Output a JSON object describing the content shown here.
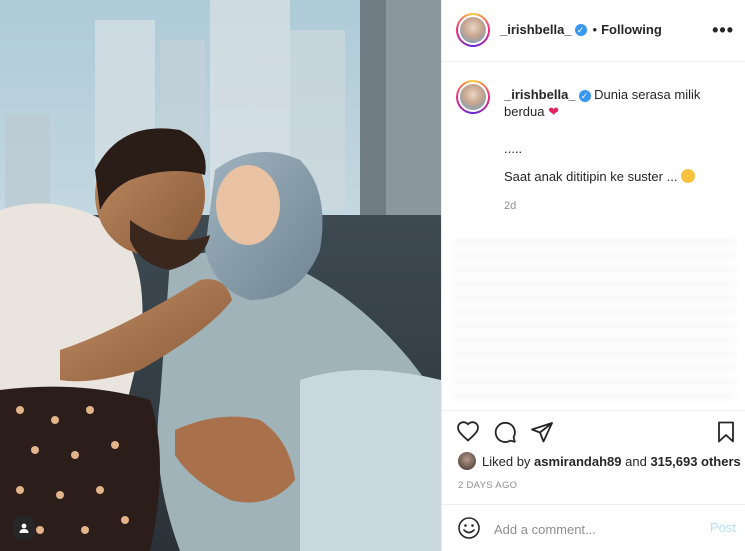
{
  "post": {
    "username": "_irishbella_",
    "follow_status": "Following",
    "separator": "•",
    "caption_line1": "Dunia serasa milik berdua",
    "caption_ellipsis": ".....",
    "caption_line2": "Saat anak dititipin ke suster ...",
    "caption_time": "2d",
    "liked_by_prefix": "Liked by",
    "liked_by_user": "asmirandah89",
    "liked_by_and": "and",
    "liked_by_count": "315,693 others",
    "posted_ago": "2 DAYS AGO",
    "comment_placeholder": "Add a comment...",
    "post_label": "Post"
  },
  "icons": {
    "verified": "verified-badge-icon",
    "more": "more-options-icon",
    "heart_emoji": "red-heart-emoji",
    "face_emoji": "tongue-face-emoji",
    "like": "heart-icon",
    "comment": "comment-icon",
    "share": "share-icon",
    "save": "bookmark-icon",
    "smile": "emoji-icon",
    "tag": "user-tag-icon"
  },
  "colors": {
    "verified": "#3897f0",
    "post_button": "#b2dffc",
    "muted_text": "#8e8e8e",
    "heart": "#e0245e"
  }
}
